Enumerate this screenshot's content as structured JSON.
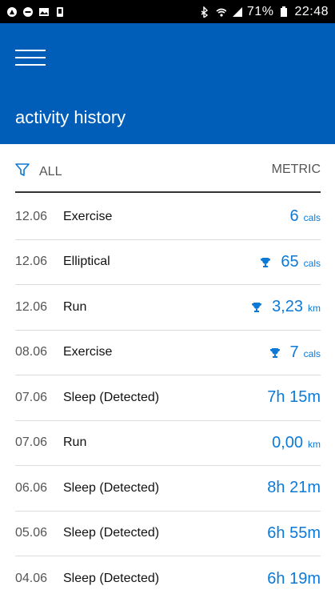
{
  "status": {
    "battery": "71%",
    "time": "22:48"
  },
  "header": {
    "title": "activity history"
  },
  "filter": {
    "label": "ALL",
    "metric": "METRIC"
  },
  "activities": [
    {
      "date": "12.06",
      "name": "Exercise",
      "value": "6",
      "unit": "cals",
      "trophy": false
    },
    {
      "date": "12.06",
      "name": "Elliptical",
      "value": "65",
      "unit": "cals",
      "trophy": true
    },
    {
      "date": "12.06",
      "name": "Run",
      "value": "3,23",
      "unit": "km",
      "trophy": true
    },
    {
      "date": "08.06",
      "name": "Exercise",
      "value": "7",
      "unit": "cals",
      "trophy": true
    },
    {
      "date": "07.06",
      "name": "Sleep (Detected)",
      "value": "7h 15m",
      "unit": "",
      "trophy": false
    },
    {
      "date": "07.06",
      "name": "Run",
      "value": "0,00",
      "unit": "km",
      "trophy": false
    },
    {
      "date": "06.06",
      "name": "Sleep (Detected)",
      "value": "8h 21m",
      "unit": "",
      "trophy": false
    },
    {
      "date": "05.06",
      "name": "Sleep (Detected)",
      "value": "6h 55m",
      "unit": "",
      "trophy": false
    },
    {
      "date": "04.06",
      "name": "Sleep (Detected)",
      "value": "6h 19m",
      "unit": "",
      "trophy": false
    }
  ],
  "colors": {
    "header_bg": "#005eb8",
    "accent": "#0d79d6"
  }
}
